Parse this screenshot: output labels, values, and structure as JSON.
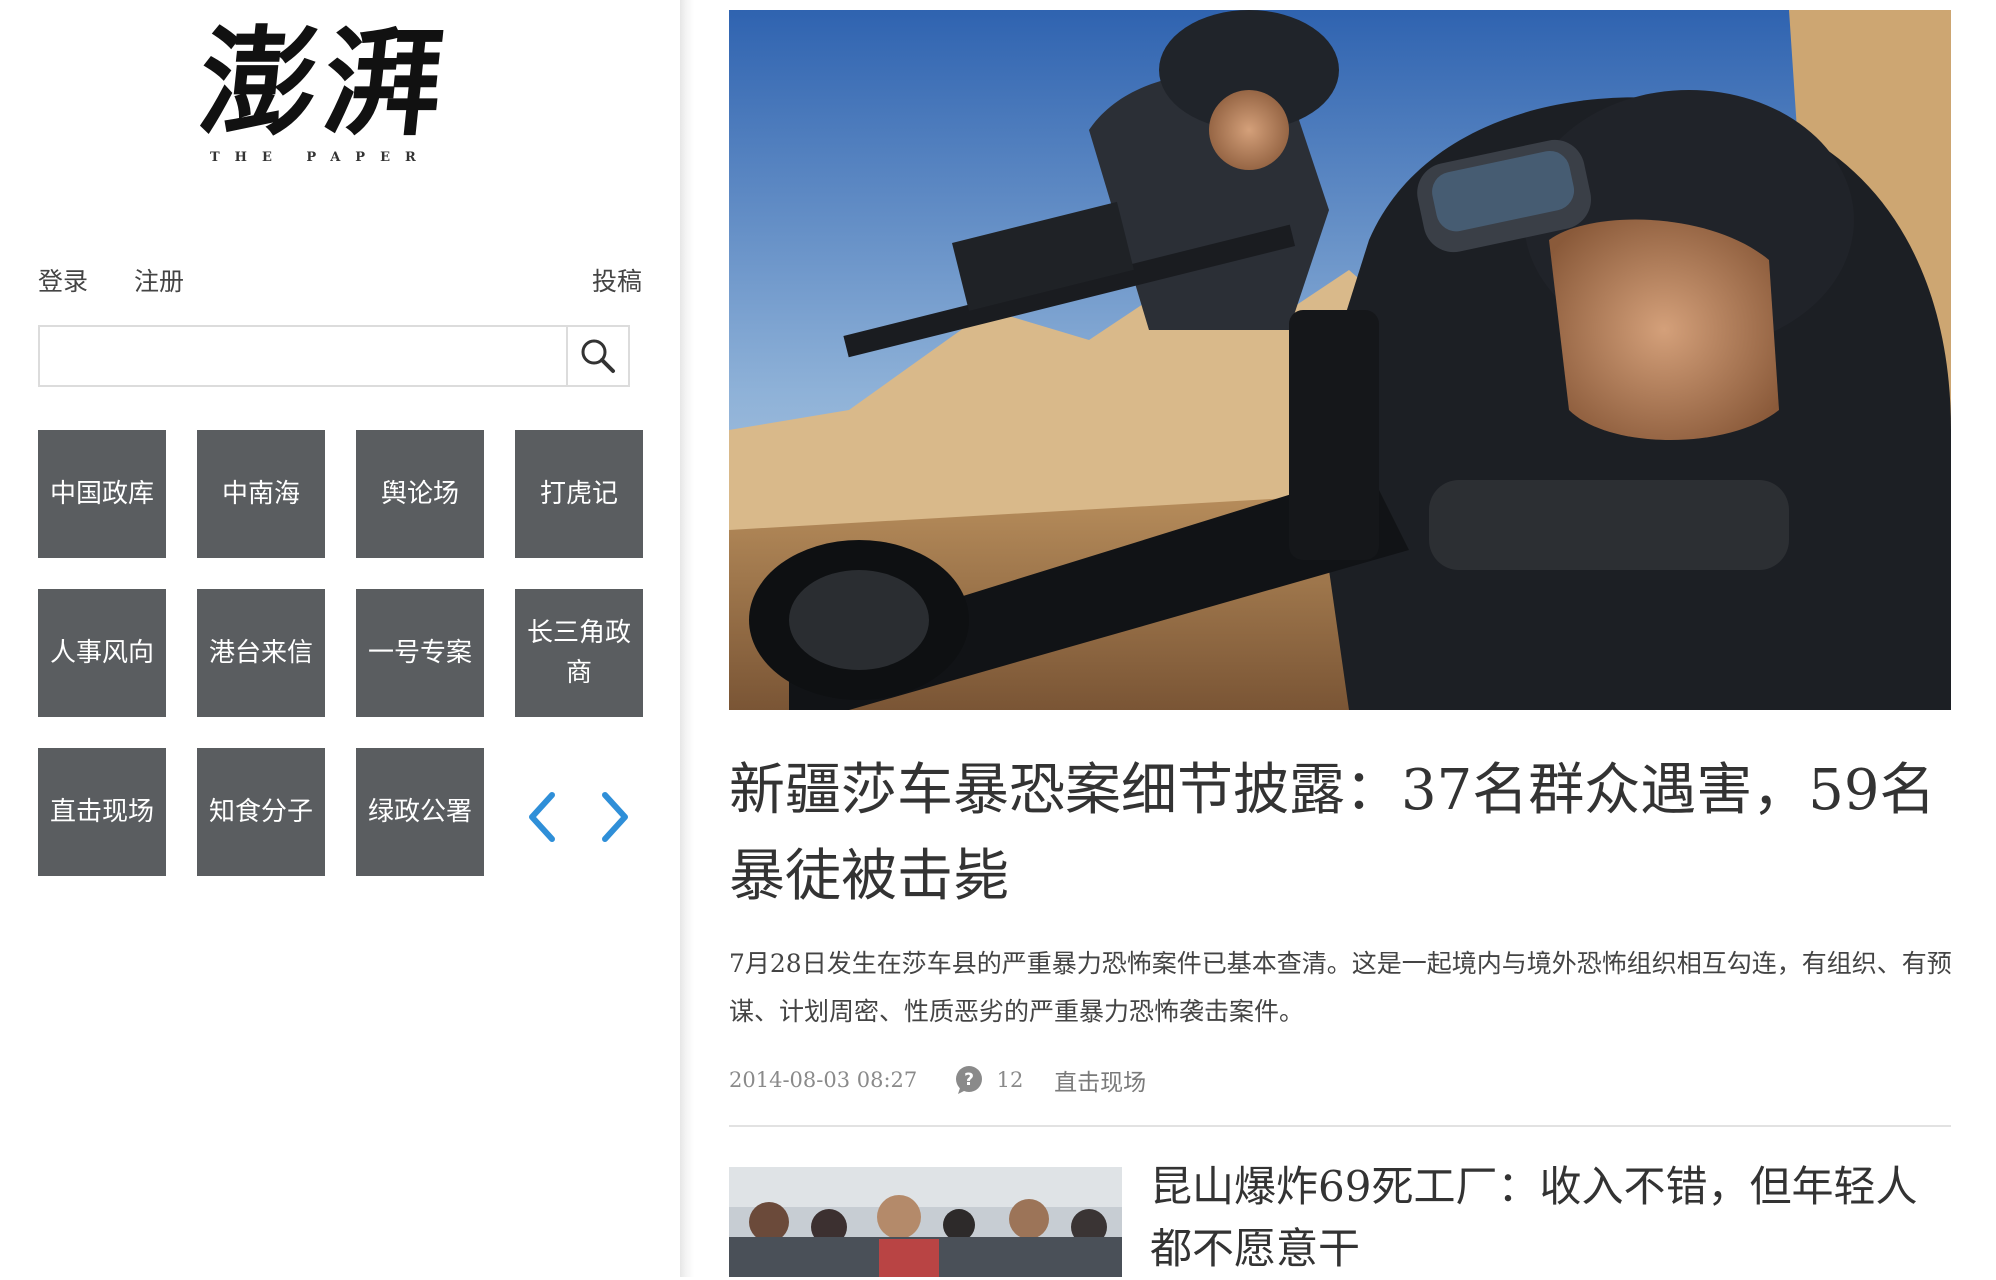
{
  "sidebar": {
    "logo": {
      "cn": "澎湃",
      "en": "THE PAPER"
    },
    "auth": {
      "login": "登录",
      "register": "注册",
      "contribute": "投稿"
    },
    "search": {
      "value": "",
      "placeholder": ""
    },
    "categories": [
      "中国政库",
      "中南海",
      "舆论场",
      "打虎记",
      "人事风向",
      "港台来信",
      "一号专案",
      "长三角政商",
      "直击现场",
      "知食分子",
      "绿政公署"
    ],
    "accent_color": "#2f8fd8",
    "tile_color": "#5a5d60"
  },
  "main": {
    "lead": {
      "image_alt_icon": "hero-photo",
      "headline": "新疆莎车暴恐案细节披露：37名群众遇害，59名暴徒被击毙",
      "summary": "7月28日发生在莎车县的严重暴力恐怖案件已基本查清。这是一起境内与境外恐怖组织相互勾连，有组织、有预谋、计划周密、性质恶劣的严重暴力恐怖袭击案件。",
      "time": "2014-08-03 08:27",
      "comments": "12",
      "section": "直击现场"
    },
    "second": {
      "headline": "昆山爆炸69死工厂：收入不错，但年轻人都不愿意干"
    }
  }
}
